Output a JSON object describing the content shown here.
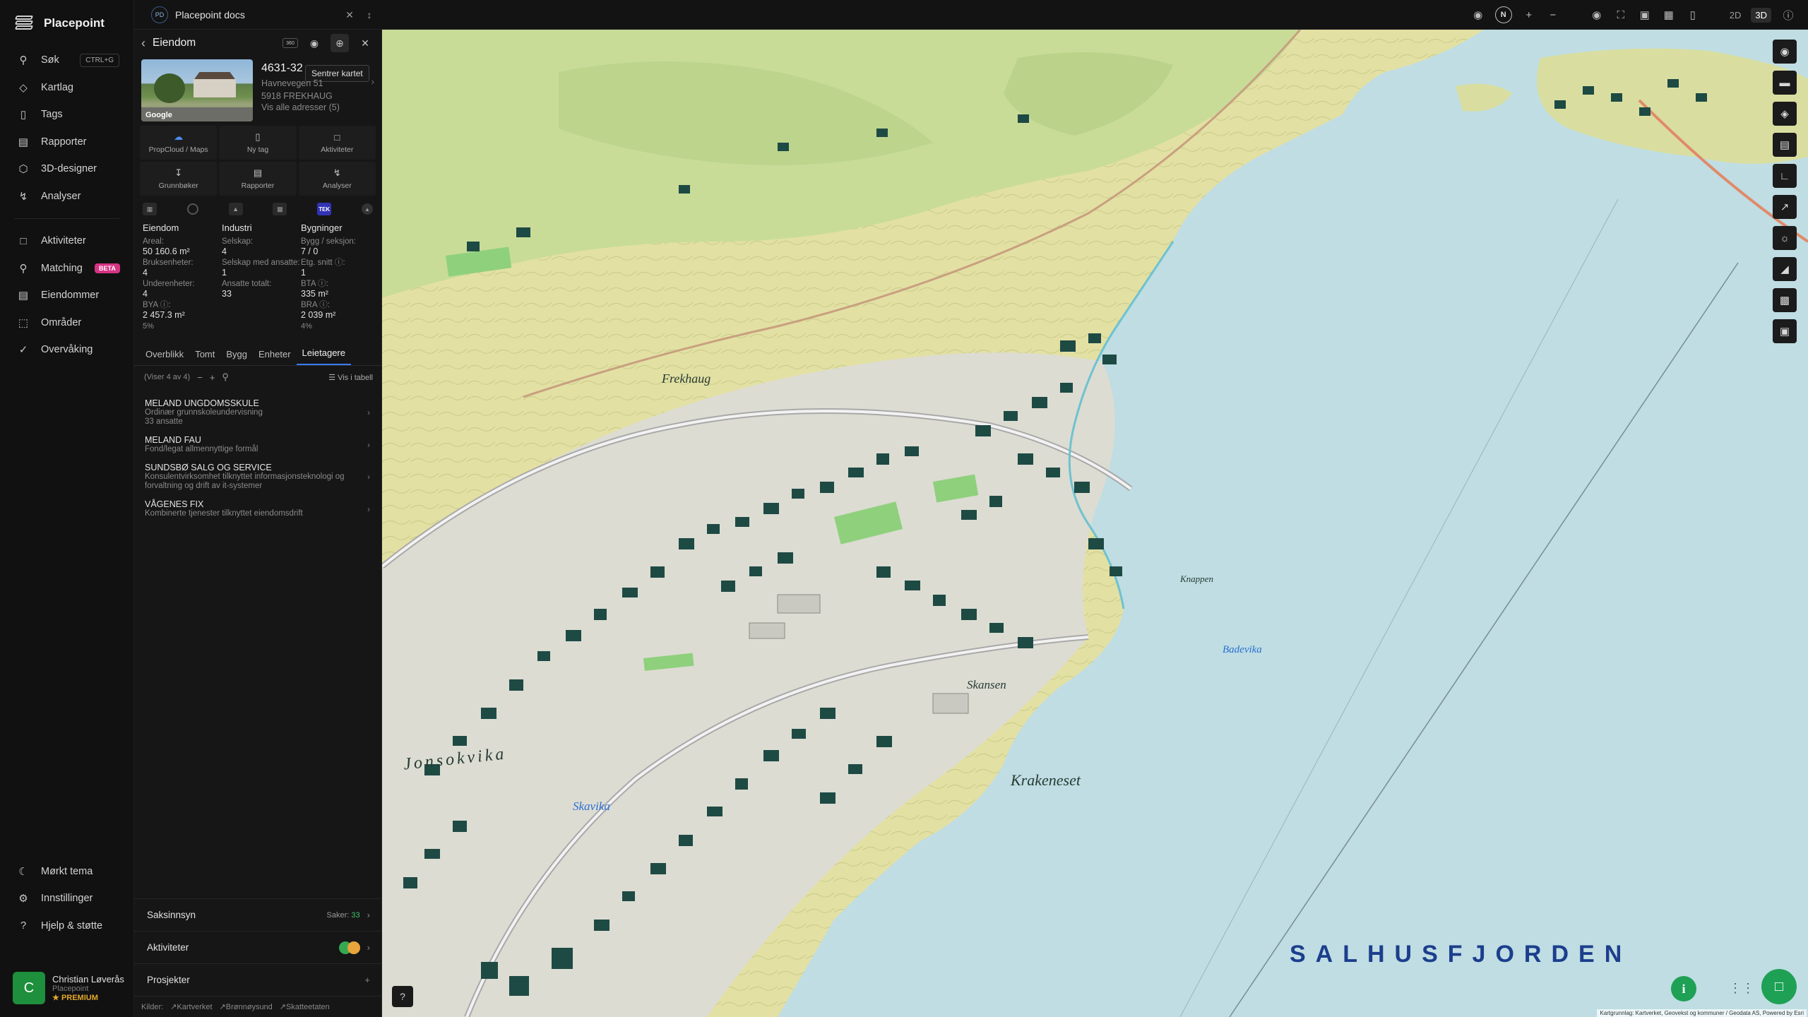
{
  "app": {
    "name": "Placepoint",
    "nav": [
      {
        "label": "Søk",
        "icon": "search-icon",
        "shortcut": "CTRL+G"
      },
      {
        "label": "Kartlag",
        "icon": "layers-icon"
      },
      {
        "label": "Tags",
        "icon": "bookmark-icon"
      },
      {
        "label": "Rapporter",
        "icon": "chart-icon"
      },
      {
        "label": "3D-designer",
        "icon": "cube-icon"
      },
      {
        "label": "Analyser",
        "icon": "bolt-icon"
      }
    ],
    "nav2": [
      {
        "label": "Aktiviteter",
        "icon": "chat-icon"
      },
      {
        "label": "Matching",
        "icon": "match-icon",
        "badge": "BETA"
      },
      {
        "label": "Eiendommer",
        "icon": "building-icon"
      },
      {
        "label": "Områder",
        "icon": "area-icon"
      },
      {
        "label": "Overvåking",
        "icon": "check-circle-icon"
      }
    ],
    "nav_bottom": [
      {
        "label": "Mørkt tema",
        "icon": "moon-icon"
      },
      {
        "label": "Innstillinger",
        "icon": "gear-icon"
      },
      {
        "label": "Hjelp & støtte",
        "icon": "help-icon"
      }
    ],
    "user": {
      "initial": "C",
      "name": "Christian Løverås",
      "org": "Placepoint",
      "plan": "PREMIUM"
    }
  },
  "topbar": {
    "doc_badge": "PD",
    "doc_title": "Placepoint docs",
    "north": "N",
    "mode_2d": "2D",
    "mode_3d": "3D"
  },
  "panel": {
    "title": "Eiendom",
    "head_badge": "360",
    "tooltip": "Sentrer kartet",
    "photo_label": "Google",
    "property_id": "4631-32",
    "address_line1": "Havnevegen 51",
    "address_line2": "5918 FREKHAUG",
    "all_addresses": "Vis alle adresser (5)",
    "actions": [
      {
        "label": "PropCloud / Maps",
        "icon": "cloud-icon"
      },
      {
        "label": "Ny tag",
        "icon": "bookmark-icon"
      },
      {
        "label": "Aktiviteter",
        "icon": "chat-icon"
      },
      {
        "label": "Grunnbøker",
        "icon": "download-icon"
      },
      {
        "label": "Rapporter",
        "icon": "chart-icon"
      },
      {
        "label": "Analyser",
        "icon": "bolt-icon"
      }
    ],
    "source_tek": "TEK",
    "stats": {
      "eiendom": {
        "title": "Eiendom",
        "areal_k": "Areal:",
        "areal_v": "50 160.6 m²",
        "bruks_k": "Bruksenheter:",
        "bruks_v": "4",
        "under_k": "Underenheter:",
        "under_v": "4",
        "bya_k": "BYA ⓘ:",
        "bya_v": "2 457.3 m²",
        "bya_pct": "5%"
      },
      "industri": {
        "title": "Industri",
        "selskap_k": "Selskap:",
        "selskap_v": "4",
        "ansatte_k": "Selskap med ansatte:",
        "ansatte_v": "1",
        "tot_k": "Ansatte totalt:",
        "tot_v": "33"
      },
      "bygninger": {
        "title": "Bygninger",
        "bygg_k": "Bygg / seksjon:",
        "bygg_v": "7 / 0",
        "etg_k": "Etg. snitt ⓘ:",
        "etg_v": "1",
        "bta_k": "BTA ⓘ:",
        "bta_v": "335 m²",
        "bra_k": "BRA ⓘ:",
        "bra_v": "2 039 m²",
        "bra_pct": "4%"
      }
    },
    "tabs": [
      "Overblikk",
      "Tomt",
      "Bygg",
      "Enheter",
      "Leietagere"
    ],
    "showing": "(Viser 4 av 4)",
    "vis_tabell": "Vis i tabell",
    "tenants": [
      {
        "name": "MELAND UNGDOMSSKULE",
        "desc": "Ordinær grunnskoleundervisning",
        "extra": "33 ansatte"
      },
      {
        "name": "MELAND FAU",
        "desc": "Fond/legat allmennyttige formål",
        "extra": ""
      },
      {
        "name": "SUNDSBØ SALG OG SERVICE",
        "desc": "Konsulentvirksomhet tilknyttet informasjonsteknologi og forvaltning og drift av it-systemer",
        "extra": ""
      },
      {
        "name": "VÅGENES FIX",
        "desc": "Kombinerte tjenester tilknyttet eiendomsdrift",
        "extra": ""
      }
    ],
    "saksinnsyn": "Saksinnsyn",
    "saker_label": "Saker:",
    "saker_count": "33",
    "aktiviteter": "Aktiviteter",
    "prosjekter": "Prosjekter",
    "sources": {
      "label": "Kilder:",
      "s1": "Kartverket",
      "s2": "Brønnøysund",
      "s3": "Skatteetaten"
    }
  },
  "map": {
    "labels": {
      "frekhaug": "Frekhaug",
      "skansen": "Skansen",
      "krakeneset": "Krakeneset",
      "jonsokvika": "Jonsokvika",
      "skavika": "Skavika",
      "badevika": "Badevika",
      "knappen": "Knappen",
      "fjord": "SALHUSFJORDEN"
    },
    "attribution": "Kartgrunnlag: Kartverket, Geovekst og kommuner / Geodata AS, Powered by Esri",
    "colors": {
      "land": "#e6e3a6",
      "forest": "#c9de9a",
      "water": "#bfdde3",
      "buildings": "#1e4a44"
    }
  }
}
